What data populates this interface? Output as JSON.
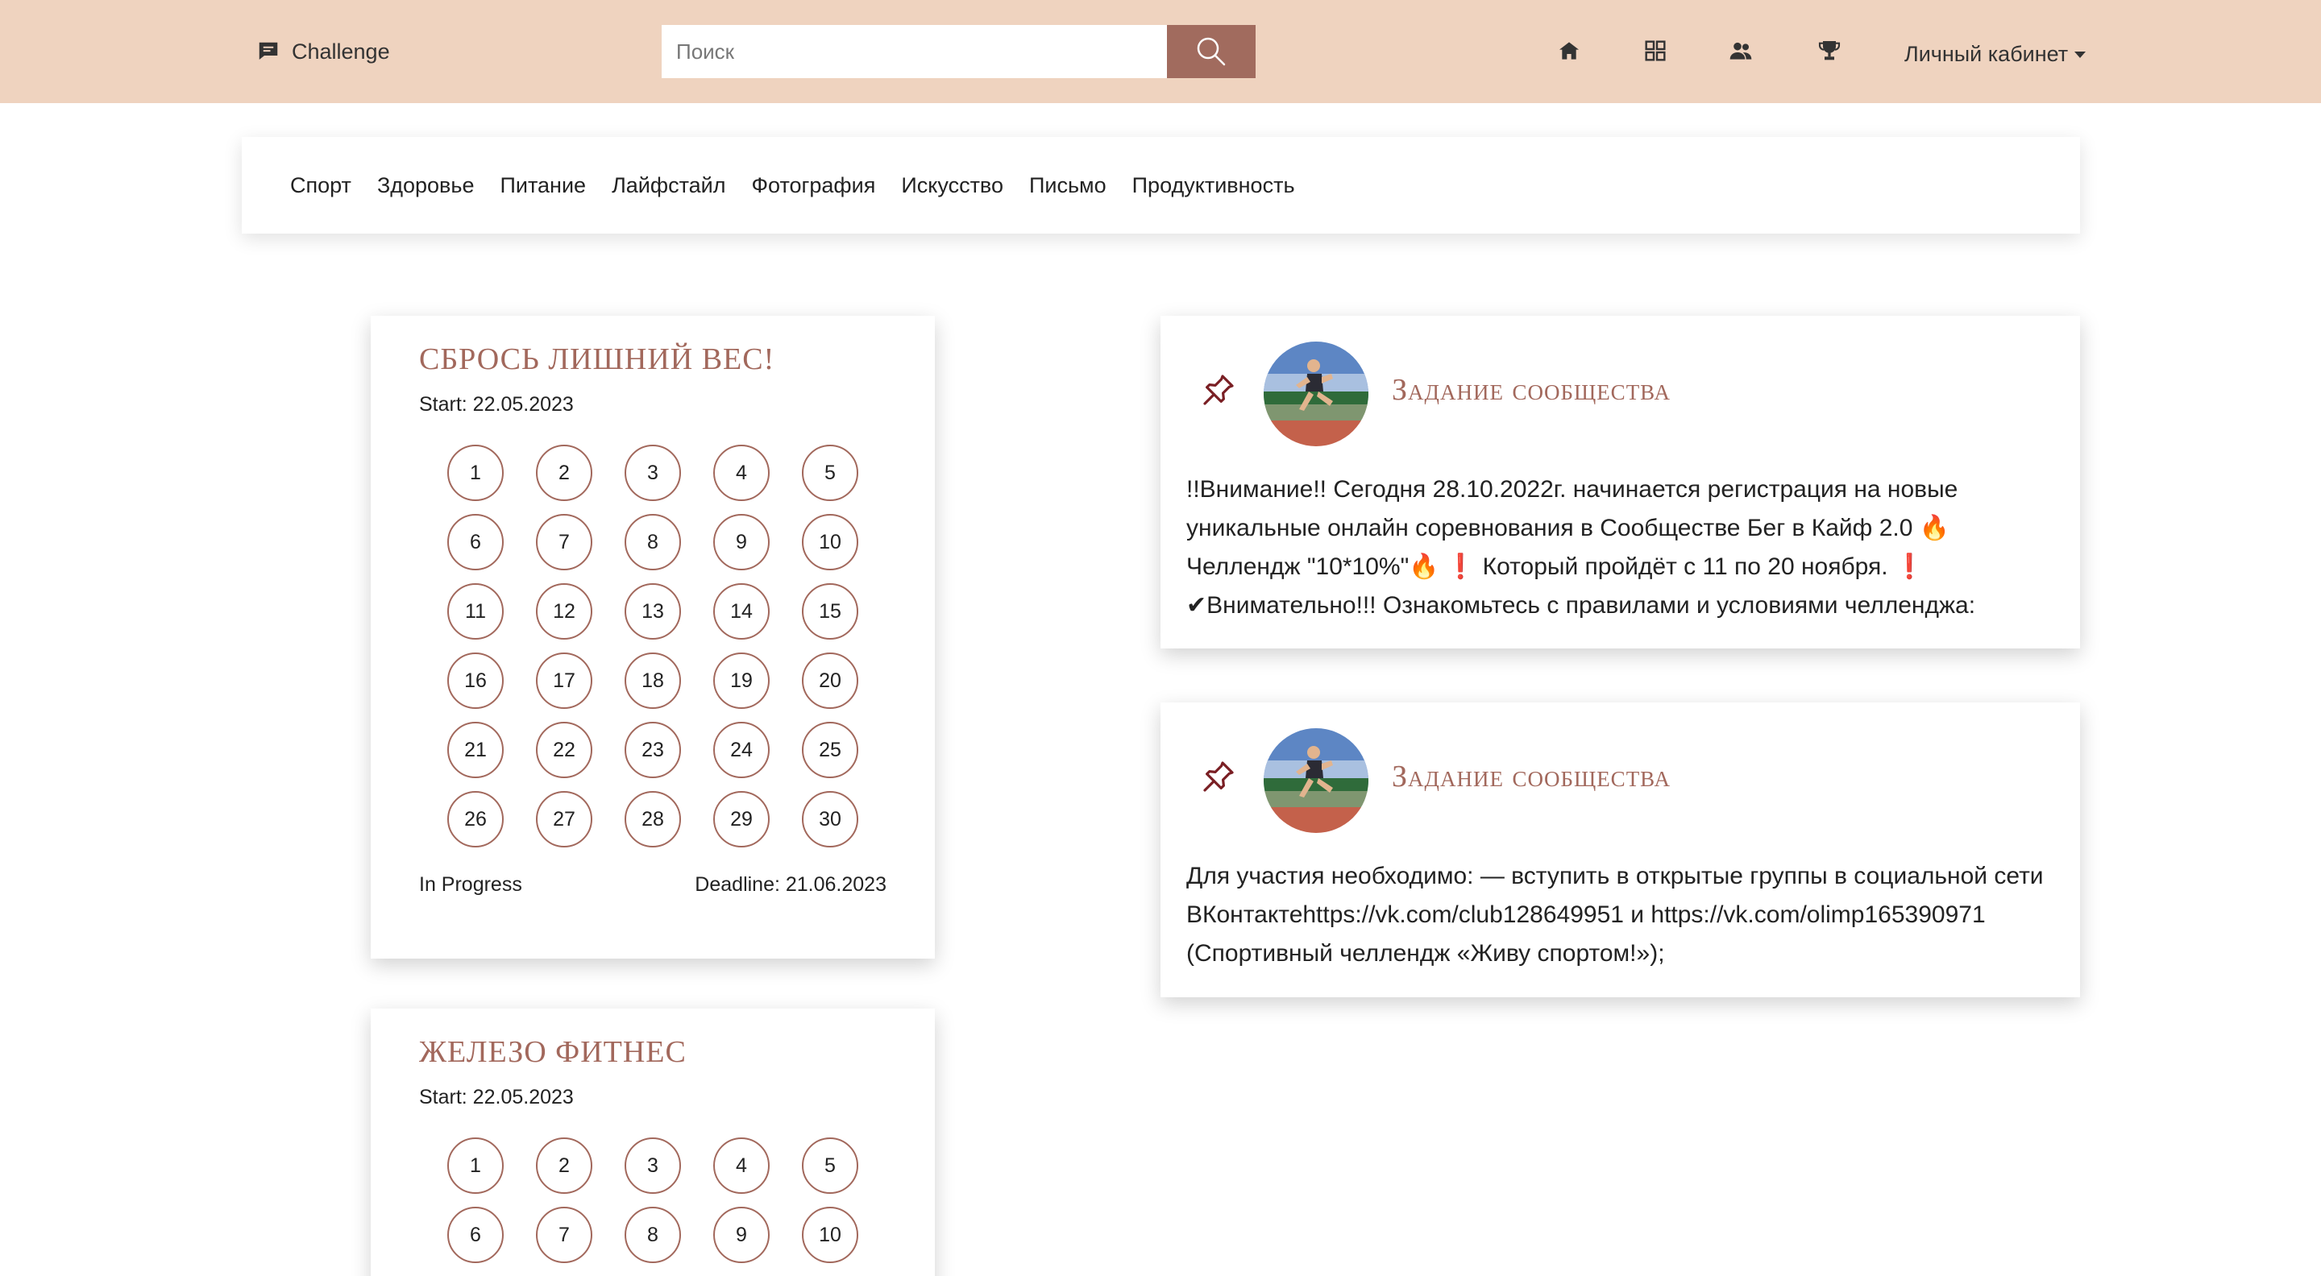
{
  "header": {
    "brand": "Challenge",
    "search_placeholder": "Поиск",
    "account": "Личный кабинет",
    "nav_icons": [
      "home-icon",
      "grid-icon",
      "users-icon",
      "trophy-icon"
    ],
    "colors": {
      "bar": "#efd3bf",
      "accent": "#a16b5e"
    }
  },
  "categories": [
    "Спорт",
    "Здоровье",
    "Питание",
    "Лайфстайл",
    "Фотография",
    "Искусство",
    "Письмо",
    "Продуктивность"
  ],
  "challenges": [
    {
      "title": "СБРОСЬ ЛИШНИЙ ВЕС!",
      "start": "Start: 22.05.2023",
      "days": [
        "1",
        "2",
        "3",
        "4",
        "5",
        "6",
        "7",
        "8",
        "9",
        "10",
        "11",
        "12",
        "13",
        "14",
        "15",
        "16",
        "17",
        "18",
        "19",
        "20",
        "21",
        "22",
        "23",
        "24",
        "25",
        "26",
        "27",
        "28",
        "29",
        "30"
      ],
      "status": "In Progress",
      "deadline": "Deadline: 21.06.2023"
    },
    {
      "title": "ЖЕЛЕЗО ФИТНЕС",
      "start": "Start: 22.05.2023",
      "days": [
        "1",
        "2",
        "3",
        "4",
        "5",
        "6",
        "7",
        "8",
        "9",
        "10"
      ]
    }
  ],
  "tasks": [
    {
      "title": "Задание сообщества",
      "lines": [
        "!!Внимание!! Сегодня 28.10.2022г. начинается регистрация на новые",
        "уникальные онлайн соревнования в Сообществе Бег в Кайф 2.0 🔥",
        "Челлендж \"10*10%\"🔥 ❗ Который пройдёт с 11 по 20 ноября. ❗",
        "✔Внимательно!!! Ознакомьтесь с правилами и условиями челленджа:"
      ]
    },
    {
      "title": "Задание сообщества",
      "lines": [
        "Для участия необходимо: — вступить в открытые группы в социальной сети",
        "ВКонтактеhttps://vk.com/club128649951 и https://vk.com/olimp165390971",
        "(Спортивный челлендж «Живу спортом!»);"
      ]
    }
  ]
}
